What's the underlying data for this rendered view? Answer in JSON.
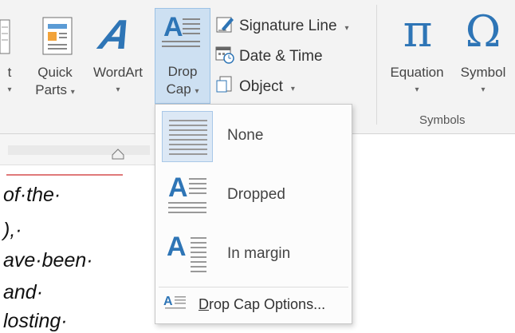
{
  "ribbon": {
    "partial_left_label": "t",
    "quick_parts": {
      "line1": "Quick",
      "line2": "Parts",
      "arrow": "▾"
    },
    "wordart": {
      "label": "WordArt",
      "arrow": "▾",
      "glyph": "A"
    },
    "drop_cap": {
      "line1": "Drop",
      "line2": "Cap",
      "arrow": "▾",
      "glyph": "A"
    },
    "signature_line": {
      "label": "Signature Line",
      "arrow": "▾"
    },
    "date_time": {
      "label": "Date & Time"
    },
    "object": {
      "label": "Object",
      "arrow": "▾"
    },
    "equation": {
      "label": "Equation",
      "arrow": "▾",
      "glyph": "π"
    },
    "symbol": {
      "label": "Symbol",
      "arrow": "▾",
      "glyph": "Ω"
    },
    "symbols_group_label": "Symbols"
  },
  "document": {
    "lines": [
      "of·the·",
      "),·",
      "ave·been·",
      "and·",
      "losting·"
    ]
  },
  "drop_cap_menu": {
    "items": [
      {
        "label": "None",
        "selected": true
      },
      {
        "label": "Dropped",
        "selected": false,
        "glyph": "A"
      },
      {
        "label": "In margin",
        "selected": false,
        "glyph": "A"
      }
    ],
    "options": {
      "label_rest": "rop Cap Options...",
      "accel": "D",
      "glyph": "A"
    }
  },
  "colors": {
    "accent_blue": "#2e75b6",
    "selected_bg": "#cde0f2",
    "ruler_red": "#e0797a"
  },
  "icons": [
    "quick-parts-icon",
    "wordart-icon",
    "drop-cap-icon",
    "signature-line-icon",
    "date-time-icon",
    "object-icon",
    "equation-icon",
    "symbol-icon"
  ]
}
